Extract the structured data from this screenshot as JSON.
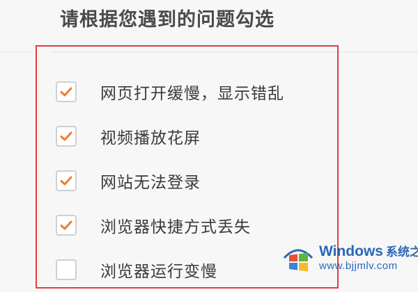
{
  "page": {
    "title": "请根据您遇到的问题勾选"
  },
  "colors": {
    "highlight_border": "#e43c3c",
    "checkmark": "#f07d2a",
    "checkbox_border": "#cfcfcf",
    "watermark_blue": "#1e5fb4"
  },
  "options": [
    {
      "label": "网页打开缓慢，显示错乱",
      "checked": true
    },
    {
      "label": "视频播放花屏",
      "checked": true
    },
    {
      "label": "网站无法登录",
      "checked": true
    },
    {
      "label": "浏览器快捷方式丢失",
      "checked": true
    },
    {
      "label": "浏览器运行变慢",
      "checked": false
    }
  ],
  "watermark": {
    "brand": "Windows",
    "suffix": "系统之家",
    "url": "www.bjjmlv.com",
    "icon": "windows-logo-icon"
  }
}
